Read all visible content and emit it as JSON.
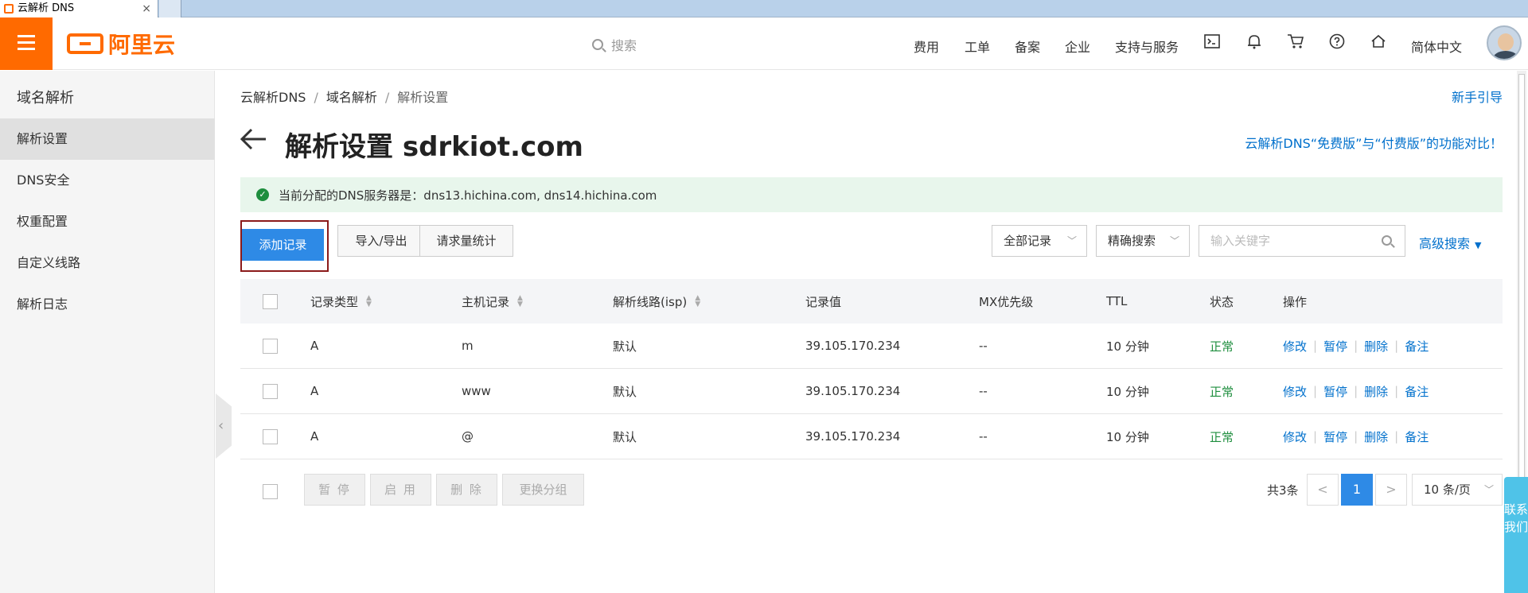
{
  "browser": {
    "tab_title": "云解析 DNS",
    "tab_close": "×"
  },
  "brand": {
    "logo_text": "阿里云",
    "accent": "#ff6a00"
  },
  "topnav": {
    "search_placeholder": "搜索",
    "items": [
      "费用",
      "工单",
      "备案",
      "企业",
      "支持与服务"
    ],
    "language": "简体中文",
    "icons": [
      "terminal-icon",
      "bell-icon",
      "cart-icon",
      "help-icon",
      "home-icon"
    ]
  },
  "sidebar": {
    "title": "域名解析",
    "items": [
      {
        "label": "解析设置",
        "active": true
      },
      {
        "label": "DNS安全"
      },
      {
        "label": "权重配置"
      },
      {
        "label": "自定义线路"
      },
      {
        "label": "解析日志"
      }
    ]
  },
  "breadcrumb": [
    "云解析DNS",
    "域名解析",
    "解析设置"
  ],
  "guide_link": "新手引导",
  "page_title": "解析设置 sdrkiot.com",
  "compare_link": "云解析DNS“免费版”与“付费版”的功能对比！",
  "notice": "当前分配的DNS服务器是：dns13.hichina.com, dns14.hichina.com",
  "toolbar": {
    "add": "添加记录",
    "import_export": "导入/导出",
    "request_stats": "请求量统计",
    "record_filter": "全部记录",
    "search_mode": "精确搜索",
    "keyword_placeholder": "输入关键字",
    "advanced": "高级搜索"
  },
  "table": {
    "headers": [
      "记录类型",
      "主机记录",
      "解析线路(isp)",
      "记录值",
      "MX优先级",
      "TTL",
      "状态",
      "操作"
    ],
    "rows": [
      {
        "type": "A",
        "host": "m",
        "line": "默认",
        "value": "39.105.170.234",
        "mx": "--",
        "ttl": "10 分钟",
        "status": "正常"
      },
      {
        "type": "A",
        "host": "www",
        "line": "默认",
        "value": "39.105.170.234",
        "mx": "--",
        "ttl": "10 分钟",
        "status": "正常"
      },
      {
        "type": "A",
        "host": "@",
        "line": "默认",
        "value": "39.105.170.234",
        "mx": "--",
        "ttl": "10 分钟",
        "status": "正常"
      }
    ],
    "actions": [
      "修改",
      "暂停",
      "删除",
      "备注"
    ]
  },
  "footer": {
    "bulk": [
      "暂 停",
      "启 用",
      "删 除",
      "更换分组"
    ],
    "total": "共3条",
    "prev": "<",
    "page": "1",
    "next": ">",
    "page_size": "10 条/页"
  },
  "float_button": "联系我们"
}
